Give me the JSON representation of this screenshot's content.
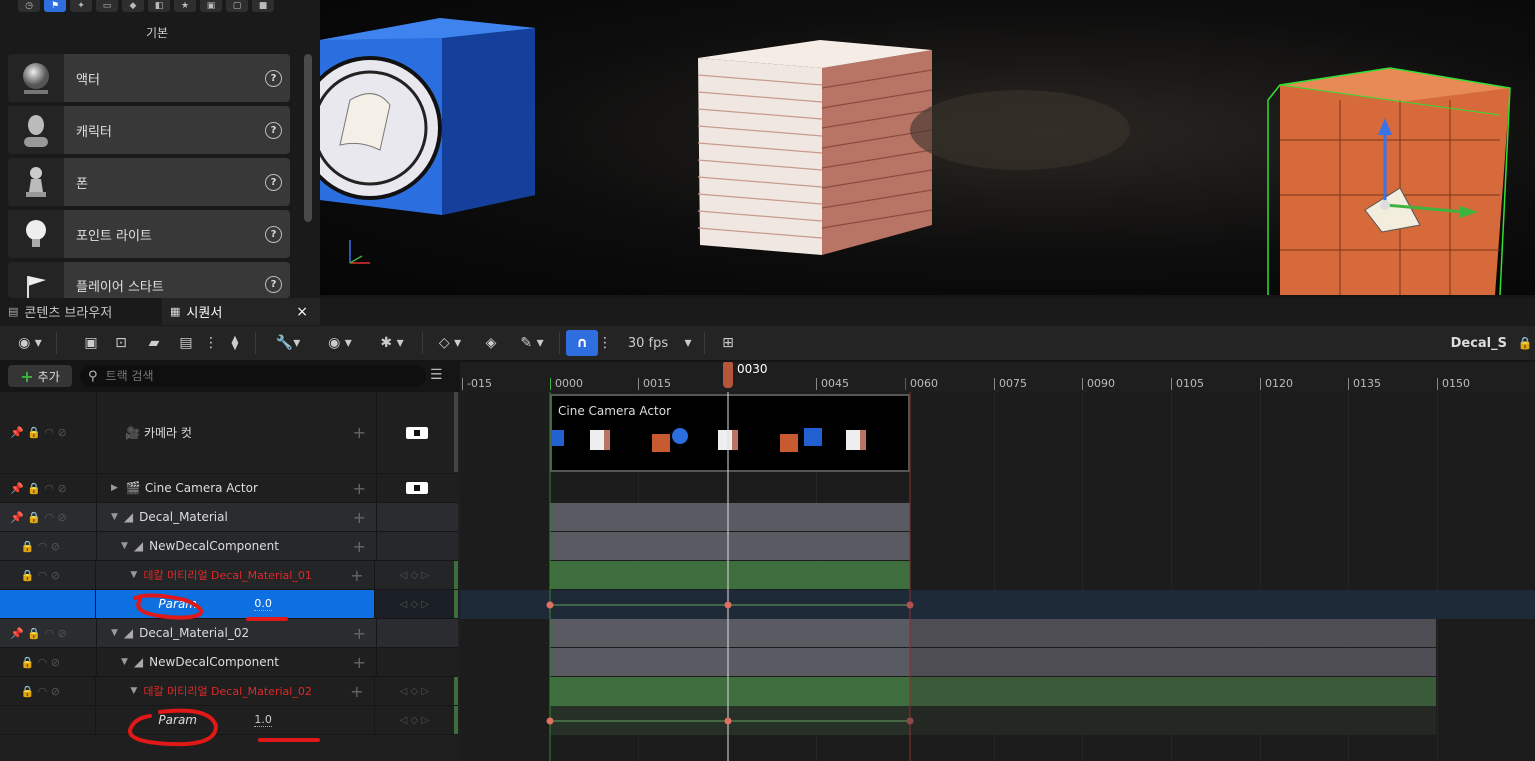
{
  "place_panel": {
    "category": "기본",
    "items": [
      {
        "label": "액터",
        "icon": "sphere-icon"
      },
      {
        "label": "캐릭터",
        "icon": "character-icon"
      },
      {
        "label": "폰",
        "icon": "pawn-icon"
      },
      {
        "label": "포인트 라이트",
        "icon": "light-bulb-icon"
      },
      {
        "label": "플레이어 스타트",
        "icon": "flag-icon"
      }
    ],
    "help": "?"
  },
  "tabs": [
    {
      "label": "콘텐츠 브라우저",
      "active": false
    },
    {
      "label": "시퀀서",
      "active": true,
      "close": "×"
    }
  ],
  "toolbar": {
    "fps": "30 fps",
    "sequence_name": "Decal_S"
  },
  "add_button": {
    "label": "추가",
    "plus": "+"
  },
  "search": {
    "placeholder": "트랙 검색"
  },
  "playhead": {
    "label": "0030"
  },
  "ruler_ticks": [
    "-015",
    "0000",
    "0015",
    "0030",
    "0045",
    "0060",
    "0075",
    "0090",
    "0105",
    "0120",
    "0135",
    "0150"
  ],
  "section": {
    "label": "Cine Camera Actor"
  },
  "tracks": [
    {
      "label": "카메라 컷"
    },
    {
      "label": "Cine Camera Actor"
    },
    {
      "label": "Decal_Material"
    },
    {
      "label": "NewDecalComponent"
    },
    {
      "label": "데칼 머티리얼 Decal_Material_01"
    },
    {
      "label": "Param",
      "value": "0.0"
    },
    {
      "label": "Decal_Material_02"
    },
    {
      "label": "NewDecalComponent"
    },
    {
      "label": "데칼 머티리얼 Decal_Material_02"
    },
    {
      "label": "Param",
      "value": "1.0"
    }
  ],
  "colors": {
    "accent": "#2f6ede",
    "selected_row": "#0d6fe0",
    "track_green": "#3e6e3e",
    "track_gray": "#5a5a62",
    "annotation_red": "#e01818"
  }
}
